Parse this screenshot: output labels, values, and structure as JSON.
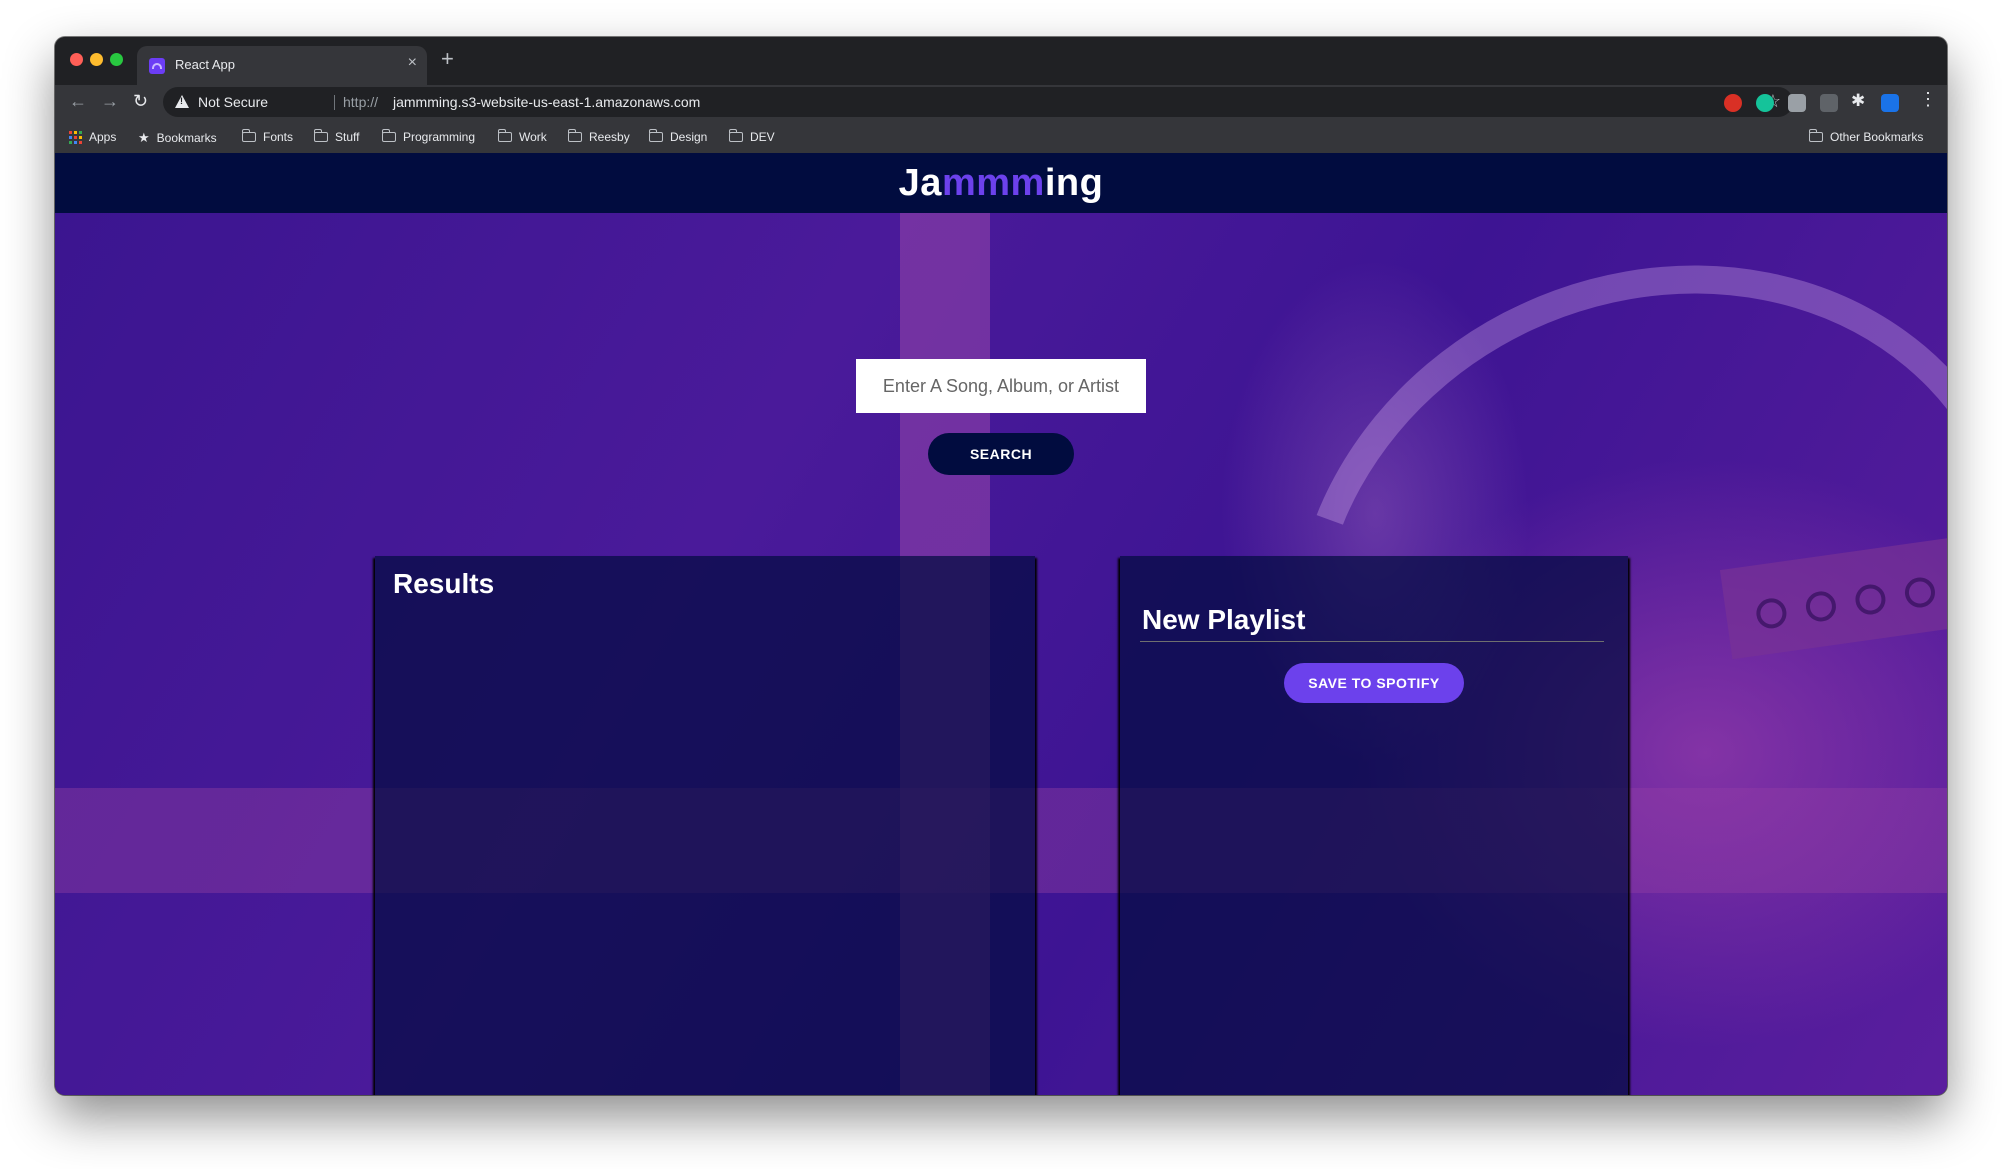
{
  "browser": {
    "tab": {
      "title": "React App",
      "close_glyph": "×"
    },
    "new_tab_glyph": "+",
    "nav": {
      "back": "←",
      "forward": "→",
      "reload": "↻",
      "menu": "⋮",
      "star": "☆",
      "puzzle": "✱"
    },
    "omnibox": {
      "security_label": "Not Secure",
      "url_scheme": "http://",
      "url_host": "jammming.s3-website-us-east-1.amazonaws.com"
    },
    "bookmarks": [
      {
        "label": "Apps",
        "icon": "apps-grid-icon"
      },
      {
        "label": "Bookmarks",
        "icon": "star-icon"
      },
      {
        "label": "Fonts",
        "icon": "folder-icon"
      },
      {
        "label": "Stuff",
        "icon": "folder-icon"
      },
      {
        "label": "Programming",
        "icon": "folder-icon"
      },
      {
        "label": "Work",
        "icon": "folder-icon"
      },
      {
        "label": "Reesby",
        "icon": "folder-icon"
      },
      {
        "label": "Design",
        "icon": "folder-icon"
      },
      {
        "label": "DEV",
        "icon": "folder-icon"
      }
    ],
    "other_bookmarks": "Other Bookmarks"
  },
  "app": {
    "logo": {
      "part1": "Ja",
      "highlight": "mmm",
      "part2": "ing"
    },
    "search": {
      "placeholder": "Enter A Song, Album, or Artist",
      "button_label": "SEARCH"
    },
    "results": {
      "title": "Results"
    },
    "playlist": {
      "name": "New Playlist",
      "save_label": "SAVE TO SPOTIFY"
    }
  },
  "colors": {
    "header_bg": "#010c3f",
    "accent": "#6c41ec",
    "hero_purple": "#4a1a9a"
  }
}
